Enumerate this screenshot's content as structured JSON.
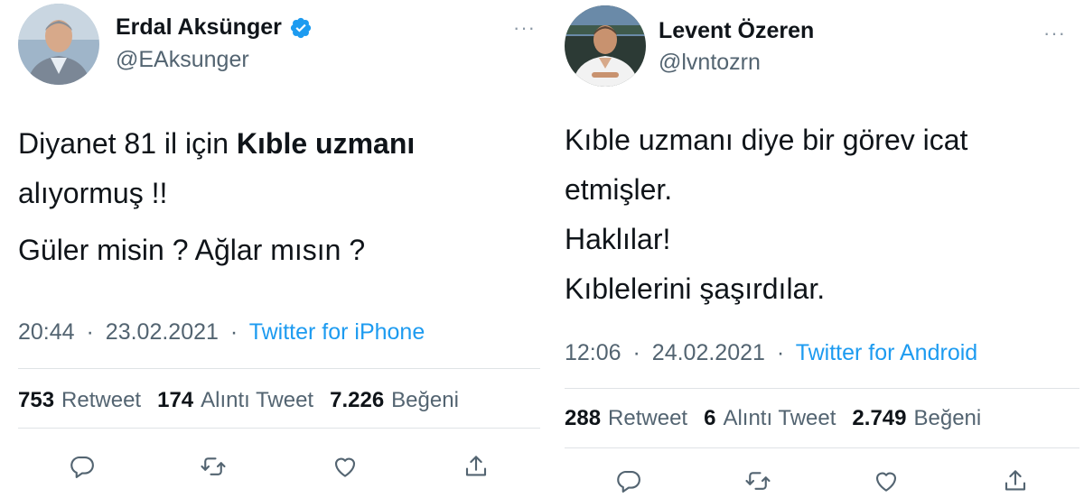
{
  "tweets": [
    {
      "author": {
        "display_name": "Erdal Aksünger",
        "handle": "@EAksunger",
        "verified": true
      },
      "more_label": "···",
      "text": {
        "line1_plain": "Diyanet 81 il için ",
        "line1_bold": "Kıble uzmanı",
        "line2": "alıyormuş !!",
        "line3": "Güler misin ? Ağlar mısın ?"
      },
      "time": "20:44",
      "date": "23.02.2021",
      "separator": "·",
      "source": "Twitter for iPhone",
      "stats": {
        "retweets": {
          "count": "753",
          "label": "Retweet"
        },
        "quotes": {
          "count": "174",
          "label": "Alıntı Tweet"
        },
        "likes": {
          "count": "7.226",
          "label": "Beğeni"
        }
      }
    },
    {
      "author": {
        "display_name": "Levent Özeren",
        "handle": "@lvntozrn",
        "verified": false
      },
      "more_label": "···",
      "text": {
        "line1": "Kıble uzmanı diye bir görev icat",
        "line2": "etmişler.",
        "line3": "Haklılar!",
        "line4": "Kıblelerini şaşırdılar."
      },
      "time": "12:06",
      "date": "24.02.2021",
      "separator": "·",
      "source": "Twitter for Android",
      "stats": {
        "retweets": {
          "count": "288",
          "label": "Retweet"
        },
        "quotes": {
          "count": "6",
          "label": "Alıntı Tweet"
        },
        "likes": {
          "count": "2.749",
          "label": "Beğeni"
        }
      }
    }
  ],
  "colors": {
    "link": "#1d9bf0",
    "muted": "#536471",
    "text": "#0f1419",
    "divider": "#dfe3e6",
    "icon": "#536471"
  },
  "icons": [
    "reply-icon",
    "retweet-icon",
    "like-icon",
    "share-icon",
    "verified-badge-icon",
    "more-icon"
  ]
}
